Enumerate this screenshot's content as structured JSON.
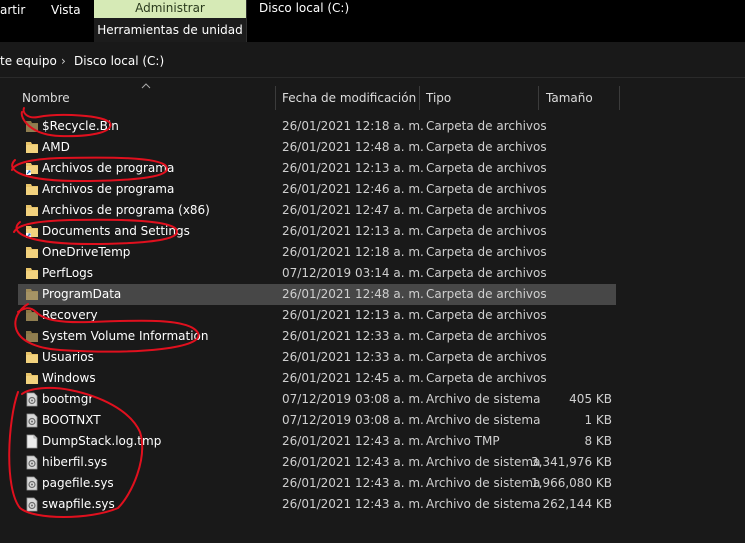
{
  "ribbon": {
    "tab_share": "artir",
    "tab_view": "Vista",
    "context_header": "Administrar",
    "context_tab": "Herramientas de unidad",
    "window_title": "Disco local (C:)"
  },
  "address": {
    "segment_1": "te equipo",
    "segment_2": "Disco local (C:)",
    "separator": "›"
  },
  "columns": {
    "name": "Nombre",
    "date": "Fecha de modificación",
    "type": "Tipo",
    "size": "Tamaño"
  },
  "files": [
    {
      "name": "$Recycle.Bin",
      "date": "26/01/2021 12:18 a. m.",
      "type": "Carpeta de archivos",
      "size": "",
      "icon": "folder-icon-dim"
    },
    {
      "name": "AMD",
      "date": "26/01/2021 12:48 a. m.",
      "type": "Carpeta de archivos",
      "size": "",
      "icon": "folder-icon"
    },
    {
      "name": "Archivos de programa",
      "date": "26/01/2021 12:13 a. m.",
      "type": "Carpeta de archivos",
      "size": "",
      "icon": "folder-shortcut-icon"
    },
    {
      "name": "Archivos de programa",
      "date": "26/01/2021 12:46 a. m.",
      "type": "Carpeta de archivos",
      "size": "",
      "icon": "folder-icon"
    },
    {
      "name": "Archivos de programa (x86)",
      "date": "26/01/2021 12:47 a. m.",
      "type": "Carpeta de archivos",
      "size": "",
      "icon": "folder-icon"
    },
    {
      "name": "Documents and Settings",
      "date": "26/01/2021 12:13 a. m.",
      "type": "Carpeta de archivos",
      "size": "",
      "icon": "folder-shortcut-icon"
    },
    {
      "name": "OneDriveTemp",
      "date": "26/01/2021 12:18 a. m.",
      "type": "Carpeta de archivos",
      "size": "",
      "icon": "folder-icon"
    },
    {
      "name": "PerfLogs",
      "date": "07/12/2019 03:14 a. m.",
      "type": "Carpeta de archivos",
      "size": "",
      "icon": "folder-icon"
    },
    {
      "name": "ProgramData",
      "date": "26/01/2021 12:48 a. m.",
      "type": "Carpeta de archivos",
      "size": "",
      "icon": "folder-icon-dim"
    },
    {
      "name": "Recovery",
      "date": "26/01/2021 12:13 a. m.",
      "type": "Carpeta de archivos",
      "size": "",
      "icon": "folder-icon-dim"
    },
    {
      "name": "System Volume Information",
      "date": "26/01/2021 12:33 a. m.",
      "type": "Carpeta de archivos",
      "size": "",
      "icon": "folder-icon-dim"
    },
    {
      "name": "Usuarios",
      "date": "26/01/2021 12:33 a. m.",
      "type": "Carpeta de archivos",
      "size": "",
      "icon": "folder-icon"
    },
    {
      "name": "Windows",
      "date": "26/01/2021 12:45 a. m.",
      "type": "Carpeta de archivos",
      "size": "",
      "icon": "folder-icon"
    },
    {
      "name": "bootmgr",
      "date": "07/12/2019 03:08 a. m.",
      "type": "Archivo de sistema",
      "size": "405 KB",
      "icon": "system-file-icon"
    },
    {
      "name": "BOOTNXT",
      "date": "07/12/2019 03:08 a. m.",
      "type": "Archivo de sistema",
      "size": "1 KB",
      "icon": "system-file-icon"
    },
    {
      "name": "DumpStack.log.tmp",
      "date": "26/01/2021 12:43 a. m.",
      "type": "Archivo TMP",
      "size": "8 KB",
      "icon": "file-icon"
    },
    {
      "name": "hiberfil.sys",
      "date": "26/01/2021 12:43 a. m.",
      "type": "Archivo de sistema",
      "size": "3,341,976 KB",
      "icon": "system-file-icon"
    },
    {
      "name": "pagefile.sys",
      "date": "26/01/2021 12:43 a. m.",
      "type": "Archivo de sistema",
      "size": "1,966,080 KB",
      "icon": "system-file-icon"
    },
    {
      "name": "swapfile.sys",
      "date": "26/01/2021 12:43 a. m.",
      "type": "Archivo de sistema",
      "size": "262,144 KB",
      "icon": "system-file-icon"
    }
  ],
  "selected_index": 8,
  "colors": {
    "background": "#191919",
    "selection": "#474747",
    "folder": "#e8c46a",
    "annotation": "#e0101e",
    "context_tab": "#d6eab6"
  }
}
